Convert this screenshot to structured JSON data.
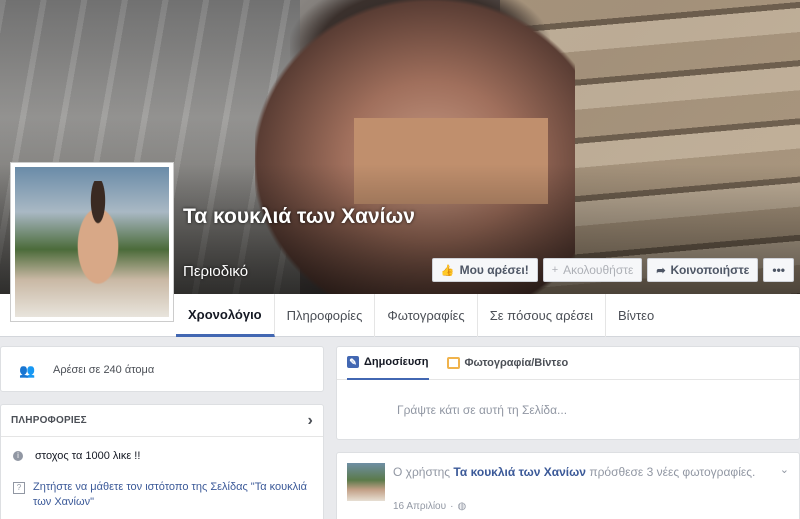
{
  "cover": {
    "page_name": "Τα κουκλιά των Χανίων",
    "category": "Περιοδικό",
    "buttons": {
      "like": "Μου αρέσει!",
      "follow": "Ακολουθήστε",
      "share": "Κοινοποιήστε",
      "more": "•••"
    }
  },
  "nav": {
    "tabs": [
      "Χρονολόγιο",
      "Πληροφορίες",
      "Φωτογραφίες",
      "Σε πόσους αρέσει",
      "Βίντεο"
    ]
  },
  "left": {
    "likes_text": "Αρέσει σε 240 άτομα",
    "about_header": "ΠΛΗΡΟΦΟΡΙΕΣ",
    "about_desc": "στοχος τα 1000 λικε !!",
    "website_prompt": "Ζητήστε να μάθετε τον ιστότοπο της Σελίδας \"Τα κουκλιά των Χανίων\""
  },
  "composer": {
    "tab_post": "Δημοσίευση",
    "tab_photo": "Φωτογραφία/Βίντεο",
    "placeholder": "Γράψτε κάτι σε αυτή τη Σελίδα..."
  },
  "post": {
    "prefix": "Ο χρήστης",
    "author": "Τα κουκλιά των Χανίων",
    "suffix": "πρόσθεσε 3 νέες φωτογραφίες.",
    "date": "16 Απριλίου",
    "privacy_sep": "·"
  },
  "colors": {
    "accent": "#4267b2",
    "link": "#3b5998",
    "background": "#e9eaed"
  }
}
